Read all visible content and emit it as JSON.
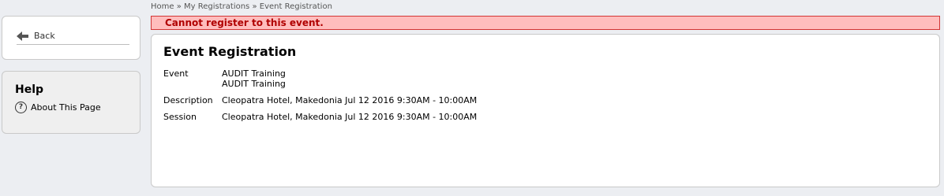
{
  "sidebar": {
    "back_label": "Back",
    "help_title": "Help",
    "help_link": "About This Page",
    "help_icon": "?"
  },
  "breadcrumb": {
    "home": "Home",
    "sep": "»",
    "my_registrations": "My Registrations",
    "current": "Event Registration"
  },
  "error": {
    "message": "Cannot register to this event."
  },
  "main": {
    "title": "Event Registration",
    "event_label": "Event",
    "event_line1": "AUDIT Training",
    "event_line2": "AUDIT Training",
    "description_label": "Description",
    "description_value": "Cleopatra Hotel, Makedonia Jul 12 2016 9:30AM - 10:00AM",
    "session_label": "Session",
    "session_value": "Cleopatra Hotel, Makedonia Jul 12 2016 9:30AM - 10:00AM"
  },
  "colors": {
    "error_bg": "#ffbdbd",
    "error_border": "#d23434",
    "error_text": "#b00000"
  }
}
